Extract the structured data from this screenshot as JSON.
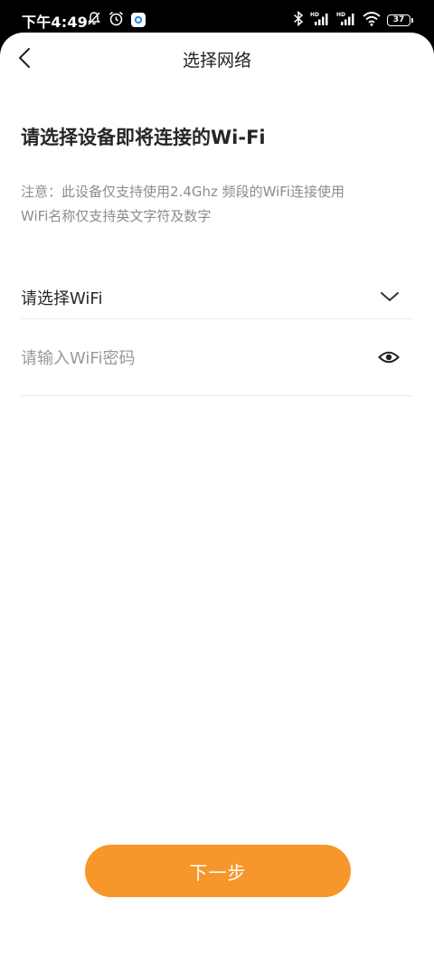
{
  "status_bar": {
    "time": "下午4:49",
    "battery_level": "37",
    "icons": [
      "muted-bell-icon",
      "alarm-icon",
      "app-notification-icon",
      "bluetooth-icon",
      "hd-signal-icon",
      "hd-signal-icon",
      "wifi-icon",
      "battery-icon"
    ]
  },
  "nav": {
    "back_icon": "chevron-left-icon",
    "title": "选择网络"
  },
  "main": {
    "heading": "请选择设备即将连接的Wi-Fi",
    "notice_line1": "注意：此设备仅支持使用2.4Ghz 频段的WiFi连接使用",
    "notice_line2": "WiFi名称仅支持英文字符及数字"
  },
  "form": {
    "wifi_select_label": "请选择WiFi",
    "wifi_select_icon": "chevron-down-icon",
    "password_value": "",
    "password_placeholder": "请输入WiFi密码",
    "password_icon": "eye-icon"
  },
  "footer": {
    "next_label": "下一步"
  },
  "colors": {
    "accent": "#f7962a",
    "text_primary": "#262626",
    "text_secondary": "#8c8c8c",
    "divider": "#ececec"
  }
}
